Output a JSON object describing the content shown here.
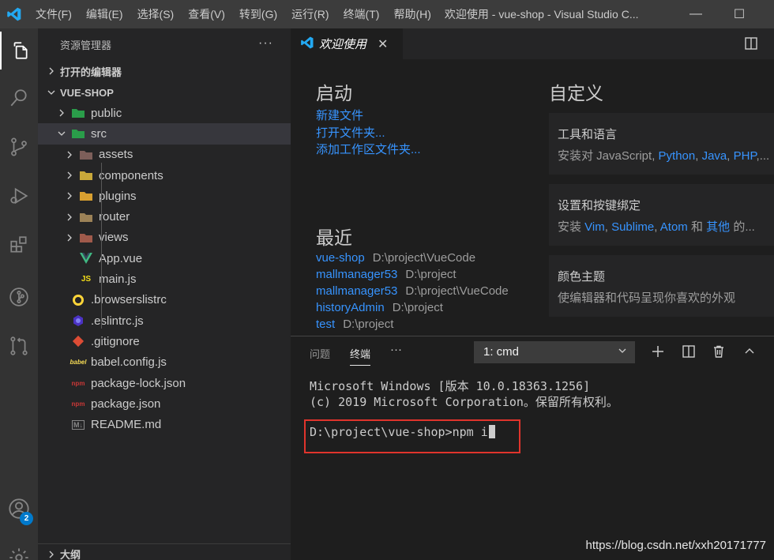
{
  "titlebar": {
    "menu": [
      "文件(F)",
      "编辑(E)",
      "选择(S)",
      "查看(V)",
      "转到(G)",
      "运行(R)",
      "终端(T)",
      "帮助(H)"
    ],
    "window_title": "欢迎使用 - vue-shop - Visual Studio C...",
    "minimize": "—",
    "maximize": "☐"
  },
  "activitybar": {
    "icons": [
      "explorer-icon",
      "search-icon",
      "source-control-icon",
      "run-debug-icon",
      "extensions-icon",
      "git-graph-icon",
      "remote-icon",
      "account-icon",
      "settings-icon"
    ],
    "account_badge": "2"
  },
  "sidebar": {
    "title": "资源管理器",
    "more": "···",
    "open_editors": "打开的编辑器",
    "project": "VUE-SHOP",
    "outline": "大纲",
    "tree": [
      {
        "label": "public",
        "type": "folder",
        "depth": 0,
        "expanded": false
      },
      {
        "label": "src",
        "type": "folder",
        "depth": 0,
        "expanded": true
      },
      {
        "label": "assets",
        "type": "folder",
        "depth": 1,
        "expanded": false
      },
      {
        "label": "components",
        "type": "folder",
        "depth": 1,
        "expanded": false
      },
      {
        "label": "plugins",
        "type": "folder",
        "depth": 1,
        "expanded": false
      },
      {
        "label": "router",
        "type": "folder",
        "depth": 1,
        "expanded": false
      },
      {
        "label": "views",
        "type": "folder",
        "depth": 1,
        "expanded": false
      },
      {
        "label": "App.vue",
        "type": "vue",
        "depth": 1
      },
      {
        "label": "main.js",
        "type": "js",
        "depth": 1
      },
      {
        "label": ".browserslistrc",
        "type": "browserslist",
        "depth": 0
      },
      {
        "label": ".eslintrc.js",
        "type": "eslint",
        "depth": 0
      },
      {
        "label": ".gitignore",
        "type": "git",
        "depth": 0
      },
      {
        "label": "babel.config.js",
        "type": "babel",
        "depth": 0
      },
      {
        "label": "package-lock.json",
        "type": "npm",
        "depth": 0
      },
      {
        "label": "package.json",
        "type": "npm",
        "depth": 0
      },
      {
        "label": "README.md",
        "type": "md",
        "depth": 0
      }
    ],
    "icon_text": {
      "js": "JS",
      "md": "M↓",
      "npm": "npm",
      "babel": "babel"
    }
  },
  "editor": {
    "tab_label": "欢迎使用",
    "tab_close": "✕",
    "start": {
      "title": "启动",
      "links": [
        "新建文件",
        "打开文件夹...",
        "添加工作区文件夹..."
      ]
    },
    "recent": {
      "title": "最近",
      "items": [
        {
          "name": "vue-shop",
          "path": "D:\\project\\VueCode"
        },
        {
          "name": "mallmanager53",
          "path": "D:\\project"
        },
        {
          "name": "mallmanager53",
          "path": "D:\\project\\VueCode"
        },
        {
          "name": "historyAdmin",
          "path": "D:\\project"
        },
        {
          "name": "test",
          "path": "D:\\project"
        }
      ]
    },
    "customize": {
      "title": "自定义",
      "cards": [
        {
          "title": "工具和语言",
          "desc_pre": "安装对 JavaScript, ",
          "links": [
            "Python",
            "Java",
            "PHP"
          ],
          "desc_post": ",..."
        },
        {
          "title": "设置和按键绑定",
          "desc_pre": "安装 ",
          "links": [
            "Vim",
            "Sublime",
            "Atom",
            "其他"
          ],
          "desc_post": " 的..."
        },
        {
          "title": "颜色主题",
          "desc_pre": "使编辑器和代码呈现你喜欢的外观",
          "links": [],
          "desc_post": ""
        }
      ]
    }
  },
  "panel": {
    "tabs": [
      "问题",
      "终端"
    ],
    "more": "···",
    "terminal_select": "1: cmd",
    "terminal_lines": [
      "Microsoft Windows [版本 10.0.18363.1256]",
      "(c) 2019 Microsoft Corporation。保留所有权利。"
    ],
    "prompt": "D:\\project\\vue-shop>npm i",
    "icons": [
      "add-terminal-icon",
      "split-terminal-icon",
      "trash-icon",
      "maximize-panel-icon"
    ]
  },
  "watermark": "https://blog.csdn.net/xxh20171777",
  "colors": {
    "accent": "#007acc",
    "link": "#3794ff",
    "highlight_box": "#e0342c"
  }
}
